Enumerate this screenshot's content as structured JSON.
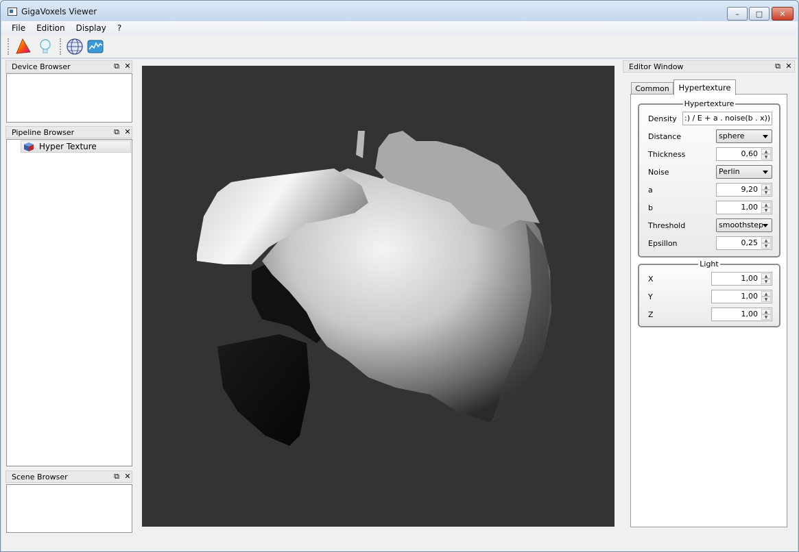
{
  "window": {
    "title": "GigaVoxels Viewer",
    "minimize": "–",
    "maximize": "□",
    "close": "✕"
  },
  "menu": {
    "items": [
      "File",
      "Edition",
      "Display",
      "?"
    ]
  },
  "toolbar": {
    "icons": [
      "shader-palette-icon",
      "light-bulb-icon",
      "globe-icon",
      "transfer-function-icon"
    ]
  },
  "docks": {
    "device_browser": {
      "title": "Device Browser"
    },
    "pipeline_browser": {
      "title": "Pipeline Browser",
      "items": [
        {
          "label": "Hyper Texture"
        }
      ]
    },
    "scene_browser": {
      "title": "Scene Browser"
    },
    "editor_window": {
      "title": "Editor Window"
    }
  },
  "editor": {
    "tabs": [
      {
        "label": "Common"
      },
      {
        "label": "Hypertexture",
        "active": true
      }
    ],
    "hypertexture": {
      "title": "Hypertexture",
      "density": {
        "label": "Density",
        "value": ":) / E + a . noise(b . x))"
      },
      "distance": {
        "label": "Distance",
        "value": "sphere"
      },
      "thickness": {
        "label": "Thickness",
        "value": "0,60"
      },
      "noise": {
        "label": "Noise",
        "value": "Perlin"
      },
      "a": {
        "label": "a",
        "value": "9,20"
      },
      "b": {
        "label": "b",
        "value": "1,00"
      },
      "threshold": {
        "label": "Threshold",
        "value": "smoothstep"
      },
      "epsillon": {
        "label": "Epsillon",
        "value": "0,25"
      }
    },
    "light": {
      "title": "Light",
      "x": {
        "label": "X",
        "value": "1,00"
      },
      "y": {
        "label": "Y",
        "value": "1,00"
      },
      "z": {
        "label": "Z",
        "value": "1,00"
      }
    }
  },
  "colors": {
    "viewport_bg": "#333333",
    "panel_bg": "#f0f0f0",
    "accent": "#3a6ea5"
  }
}
